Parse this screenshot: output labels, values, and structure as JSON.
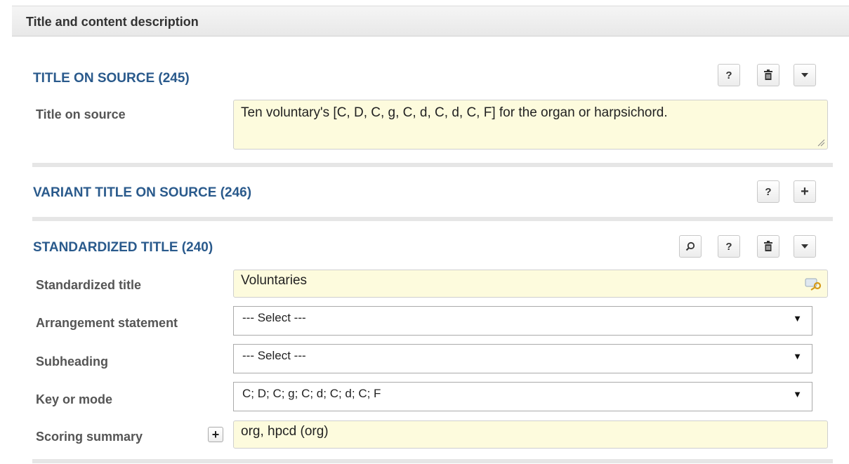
{
  "panel": {
    "title": "Title and content description"
  },
  "sections": {
    "title_on_source": {
      "heading": "TITLE ON SOURCE (245)",
      "field_label": "Title on source",
      "field_value": "Ten voluntary's [C, D, C, g, C, d, C, d, C, F] for the organ or harpsichord."
    },
    "variant_title": {
      "heading": "VARIANT TITLE ON SOURCE (246)"
    },
    "standardized_title": {
      "heading": "STANDARDIZED TITLE (240)",
      "standardized_label": "Standardized title",
      "standardized_value": "Voluntaries",
      "arrangement_label": "Arrangement statement",
      "arrangement_value": "--- Select ---",
      "subheading_label": "Subheading",
      "subheading_value": "--- Select ---",
      "key_label": "Key or mode",
      "key_value": "C; D; C; g; C; d; C; d; C; F",
      "scoring_label": "Scoring summary",
      "scoring_value": "org, hpcd (org)"
    }
  },
  "buttons": {
    "help": "?",
    "add": "+",
    "dropdown": "▼"
  },
  "icons": [
    "help-icon",
    "trash-icon",
    "caret-down-icon",
    "plus-icon",
    "search-icon",
    "key-icon"
  ]
}
